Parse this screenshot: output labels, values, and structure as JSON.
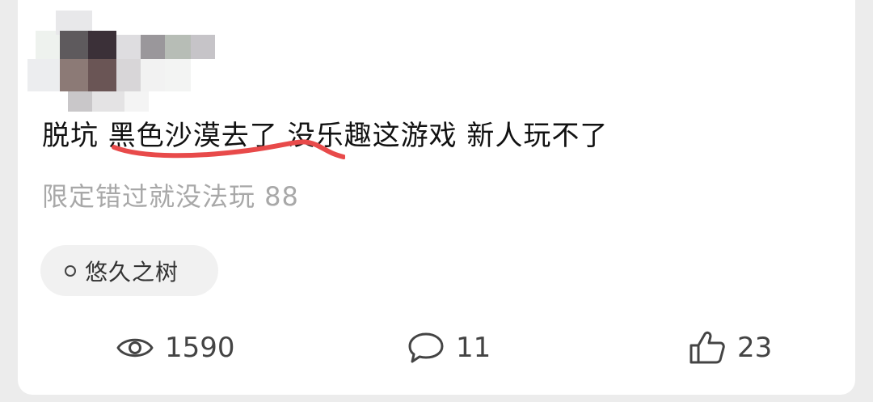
{
  "post": {
    "text": "脱坑 黑色沙漠去了 没乐趣这游戏 新人玩不了",
    "subtext": "限定错过就没法玩 88"
  },
  "tag": {
    "label": "悠久之树",
    "icon": "circle-icon"
  },
  "stats": {
    "views": "1590",
    "comments": "11",
    "likes": "23"
  },
  "colors": {
    "text": "#111111",
    "subtext": "#a8a8a8",
    "underline": "#e84a4a",
    "chip_bg": "#f1f1f1",
    "icon": "#444444"
  }
}
